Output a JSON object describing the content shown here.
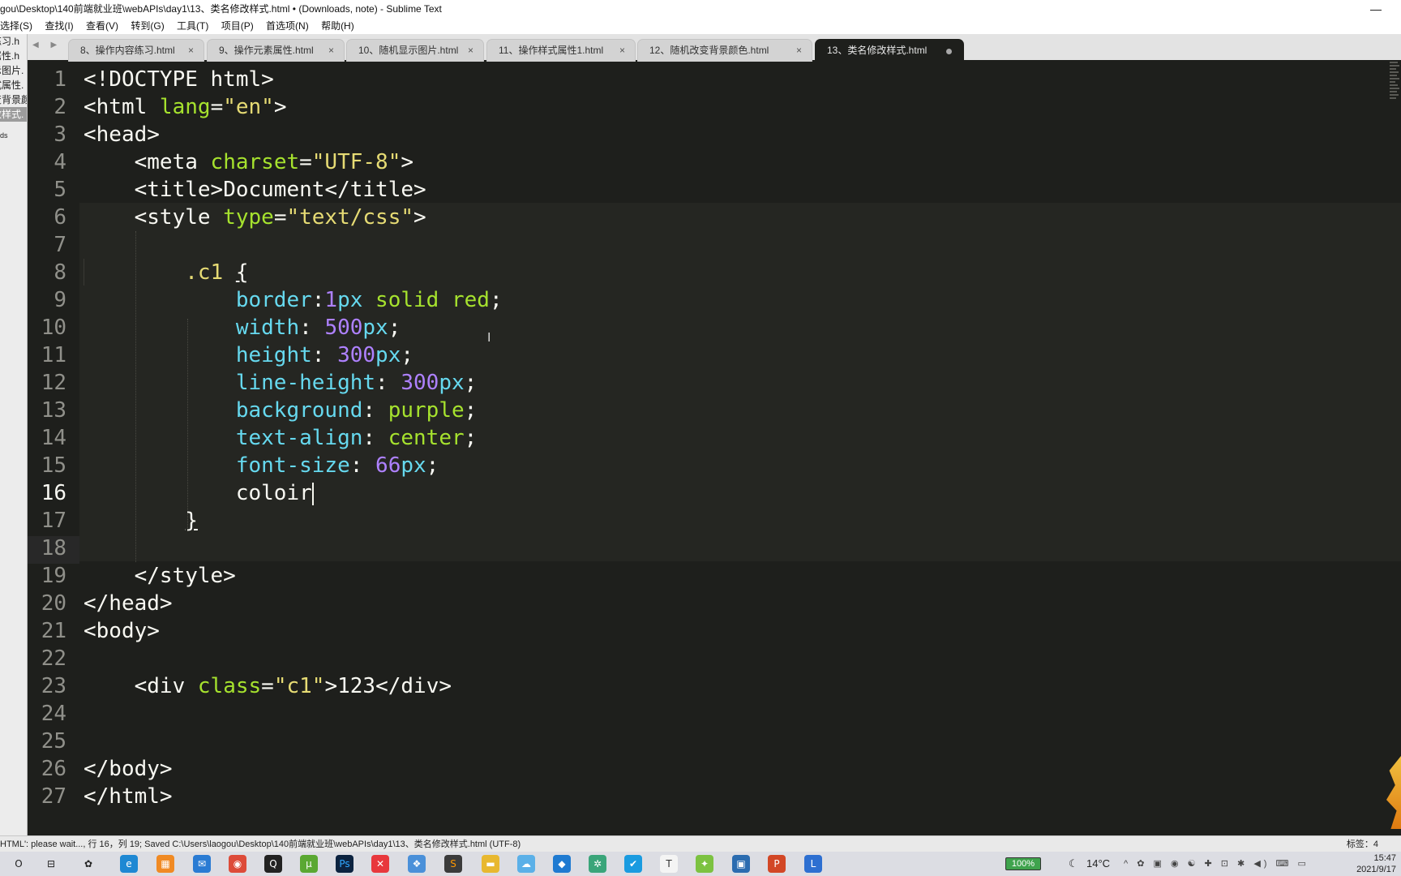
{
  "window": {
    "title": "gou\\Desktop\\140前端就业班\\webAPIs\\day1\\13、类名修改样式.html • (Downloads, note) - Sublime Text",
    "minimize_glyph": "—"
  },
  "menu": {
    "items": [
      "选择(S)",
      "查找(I)",
      "查看(V)",
      "转到(G)",
      "工具(T)",
      "项目(P)",
      "首选项(N)",
      "帮助(H)"
    ]
  },
  "sidebar": {
    "items": [
      "练习.h",
      "属性.h",
      "示图片.",
      "式属性.",
      "变背景颜",
      "改样式."
    ],
    "selected_index": 5,
    "footer": "ds"
  },
  "tabs": {
    "nav": "◀ ▶",
    "close_glyph": "×",
    "items": [
      {
        "label": "8、操作内容练习.html"
      },
      {
        "label": "9、操作元素属性.html"
      },
      {
        "label": "10、随机显示图片.html"
      },
      {
        "label": "11、操作样式属性1.html"
      },
      {
        "label": "12、随机改变背景颜色.html"
      },
      {
        "label": "13、类名修改样式.html",
        "active": true,
        "dirty": true
      }
    ]
  },
  "editor": {
    "current_line": 16,
    "line_numbers": [
      "1",
      "2",
      "3",
      "4",
      "5",
      "6",
      "7",
      "8",
      "9",
      "10",
      "11",
      "12",
      "13",
      "14",
      "15",
      "16",
      "17",
      "18",
      "19",
      "20",
      "21",
      "22",
      "23",
      "24",
      "25",
      "26",
      "27"
    ],
    "lines": [
      [
        {
          "t": "<!DOCTYPE html>",
          "c": "p"
        }
      ],
      [
        {
          "t": "<",
          "c": "p"
        },
        {
          "t": "html",
          "c": "p"
        },
        {
          "t": " lang",
          "c": "a"
        },
        {
          "t": "=",
          "c": "p"
        },
        {
          "t": "\"en\"",
          "c": "s"
        },
        {
          "t": ">",
          "c": "p"
        }
      ],
      [
        {
          "t": "<head>",
          "c": "p"
        }
      ],
      [
        {
          "t": "    <meta ",
          "c": "p"
        },
        {
          "t": "charset",
          "c": "a"
        },
        {
          "t": "=",
          "c": "p"
        },
        {
          "t": "\"UTF-8\"",
          "c": "s"
        },
        {
          "t": ">",
          "c": "p"
        }
      ],
      [
        {
          "t": "    <title>",
          "c": "p"
        },
        {
          "t": "Document",
          "c": "tx"
        },
        {
          "t": "</title>",
          "c": "p"
        }
      ],
      [
        {
          "t": "    <style ",
          "c": "p"
        },
        {
          "t": "type",
          "c": "a"
        },
        {
          "t": "=",
          "c": "p"
        },
        {
          "t": "\"text/css\"",
          "c": "s"
        },
        {
          "t": ">",
          "c": "p"
        }
      ],
      [
        {
          "t": "",
          "c": "p"
        }
      ],
      [
        {
          "t": "        ",
          "c": "p"
        },
        {
          "t": ".c1",
          "c": "sel"
        },
        {
          "t": " ",
          "c": "p"
        },
        {
          "t": "{",
          "c": "p",
          "b": true
        }
      ],
      [
        {
          "t": "            ",
          "c": "p"
        },
        {
          "t": "border",
          "c": "pv"
        },
        {
          "t": ":",
          "c": "p"
        },
        {
          "t": "1",
          "c": "n"
        },
        {
          "t": "px",
          "c": "u"
        },
        {
          "t": " solid red",
          "c": "v"
        },
        {
          "t": ";",
          "c": "p"
        }
      ],
      [
        {
          "t": "            ",
          "c": "p"
        },
        {
          "t": "width",
          "c": "pv"
        },
        {
          "t": ": ",
          "c": "p"
        },
        {
          "t": "500",
          "c": "n"
        },
        {
          "t": "px",
          "c": "u"
        },
        {
          "t": ";",
          "c": "p"
        }
      ],
      [
        {
          "t": "            ",
          "c": "p"
        },
        {
          "t": "height",
          "c": "pv"
        },
        {
          "t": ": ",
          "c": "p"
        },
        {
          "t": "300",
          "c": "n"
        },
        {
          "t": "px",
          "c": "u"
        },
        {
          "t": ";",
          "c": "p"
        }
      ],
      [
        {
          "t": "            ",
          "c": "p"
        },
        {
          "t": "line-height",
          "c": "pv"
        },
        {
          "t": ": ",
          "c": "p"
        },
        {
          "t": "300",
          "c": "n"
        },
        {
          "t": "px",
          "c": "u"
        },
        {
          "t": ";",
          "c": "p"
        }
      ],
      [
        {
          "t": "            ",
          "c": "p"
        },
        {
          "t": "background",
          "c": "pv"
        },
        {
          "t": ": ",
          "c": "p"
        },
        {
          "t": "purple",
          "c": "v"
        },
        {
          "t": ";",
          "c": "p"
        }
      ],
      [
        {
          "t": "            ",
          "c": "p"
        },
        {
          "t": "text-align",
          "c": "pv"
        },
        {
          "t": ": ",
          "c": "p"
        },
        {
          "t": "center",
          "c": "v"
        },
        {
          "t": ";",
          "c": "p"
        }
      ],
      [
        {
          "t": "            ",
          "c": "p"
        },
        {
          "t": "font-size",
          "c": "pv"
        },
        {
          "t": ": ",
          "c": "p"
        },
        {
          "t": "66",
          "c": "n"
        },
        {
          "t": "px",
          "c": "u"
        },
        {
          "t": ";",
          "c": "p"
        }
      ],
      [
        {
          "t": "            ",
          "c": "p"
        },
        {
          "t": "coloir",
          "c": "tx"
        }
      ],
      [
        {
          "t": "        ",
          "c": "p"
        },
        {
          "t": "}",
          "c": "p",
          "b": true
        }
      ],
      [
        {
          "t": "",
          "c": "p"
        }
      ],
      [
        {
          "t": "    </style>",
          "c": "p"
        }
      ],
      [
        {
          "t": "</head>",
          "c": "p"
        }
      ],
      [
        {
          "t": "<body>",
          "c": "p"
        }
      ],
      [
        {
          "t": "",
          "c": "p"
        }
      ],
      [
        {
          "t": "    <div ",
          "c": "p"
        },
        {
          "t": "class",
          "c": "a"
        },
        {
          "t": "=",
          "c": "p"
        },
        {
          "t": "\"c1\"",
          "c": "s"
        },
        {
          "t": ">",
          "c": "p"
        },
        {
          "t": "123",
          "c": "tx"
        },
        {
          "t": "</div>",
          "c": "p"
        }
      ],
      [
        {
          "t": "",
          "c": "p"
        }
      ],
      [
        {
          "t": "",
          "c": "p"
        }
      ],
      [
        {
          "t": "</body>",
          "c": "p"
        }
      ],
      [
        {
          "t": "</html>",
          "c": "p"
        }
      ]
    ]
  },
  "statusbar": {
    "left": "HTML': please wait..., 行 16，列 19; Saved C:\\Users\\laogou\\Desktop\\140前端就业班\\webAPIs\\day1\\13、类名修改样式.html (UTF-8)",
    "right": "标签：4"
  },
  "taskbar": {
    "battery": "100%",
    "weather": "14°C",
    "time": "15:47",
    "date": "2021/9/17",
    "icons": [
      {
        "name": "start-icon",
        "glyph": "O",
        "color": "transparent",
        "fg": "#222"
      },
      {
        "name": "task-view-icon",
        "glyph": "⊟",
        "color": "transparent",
        "fg": "#222"
      },
      {
        "name": "game-icon",
        "glyph": "✿",
        "color": "transparent",
        "fg": "#222"
      },
      {
        "name": "edge-icon",
        "glyph": "e",
        "color": "#1e88d3",
        "fg": "#fff"
      },
      {
        "name": "app-orange-icon",
        "glyph": "▦",
        "color": "#f08a24",
        "fg": "#fff"
      },
      {
        "name": "mail-icon",
        "glyph": "✉",
        "color": "#2a7bd3",
        "fg": "#fff"
      },
      {
        "name": "chrome-icon",
        "glyph": "◉",
        "color": "#dd4b39",
        "fg": "#fff"
      },
      {
        "name": "qq-icon",
        "glyph": "Q",
        "color": "#222",
        "fg": "#fff"
      },
      {
        "name": "utorrent-icon",
        "glyph": "µ",
        "color": "#5aa832",
        "fg": "#fff"
      },
      {
        "name": "photoshop-icon",
        "glyph": "Ps",
        "color": "#0c2340",
        "fg": "#31a8ff"
      },
      {
        "name": "xmind-icon",
        "glyph": "✕",
        "color": "#e8383d",
        "fg": "#fff"
      },
      {
        "name": "app-blue-icon",
        "glyph": "❖",
        "color": "#4a90d9",
        "fg": "#fff"
      },
      {
        "name": "sublime-icon",
        "glyph": "S",
        "color": "#3b3b3b",
        "fg": "#ff9800"
      },
      {
        "name": "folder-icon",
        "glyph": "▬",
        "color": "#e8b830",
        "fg": "#fff"
      },
      {
        "name": "weather-app-icon",
        "glyph": "☁",
        "color": "#5bb0e8",
        "fg": "#fff"
      },
      {
        "name": "vscode-icon",
        "glyph": "◆",
        "color": "#1f7ad1",
        "fg": "#fff"
      },
      {
        "name": "app-gear-icon",
        "glyph": "✲",
        "color": "#3aa57a",
        "fg": "#fff"
      },
      {
        "name": "app-check-icon",
        "glyph": "✔",
        "color": "#1a9be0",
        "fg": "#fff"
      },
      {
        "name": "typora-icon",
        "glyph": "T",
        "color": "#f4f4f4",
        "fg": "#333"
      },
      {
        "name": "app-green-icon",
        "glyph": "✦",
        "color": "#7cc241",
        "fg": "#fff"
      },
      {
        "name": "app-window-icon",
        "glyph": "▣",
        "color": "#2b6cb0",
        "fg": "#fff"
      },
      {
        "name": "powerpoint-icon",
        "glyph": "P",
        "color": "#d24726",
        "fg": "#fff"
      },
      {
        "name": "app-l-icon",
        "glyph": "L",
        "color": "#2d6fd1",
        "fg": "#fff"
      }
    ]
  }
}
